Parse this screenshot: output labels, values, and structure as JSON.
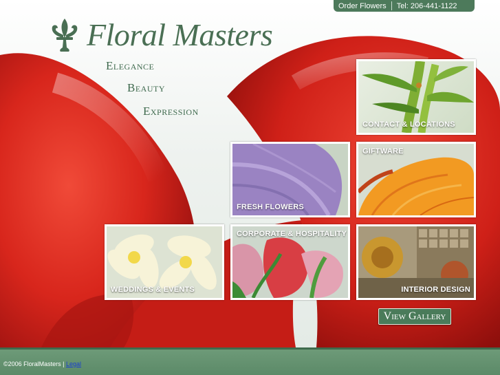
{
  "topbar": {
    "order_label": "Order Flowers",
    "phone_label": "Tel: 206-441-1122"
  },
  "brand": {
    "name": "Floral Masters",
    "logo_icon": "fleur-de-lis-icon"
  },
  "taglines": [
    "Elegance",
    "Beauty",
    "Expression"
  ],
  "tiles": [
    {
      "label": "CONTACT & LOCATIONS"
    },
    {
      "label": "GIFTWARE"
    },
    {
      "label": "FRESH FLOWERS"
    },
    {
      "label": "CORPORATE & HOSPITALITY"
    },
    {
      "label": "WEDDINGS & EVENTS"
    },
    {
      "label": "INTERIOR DESIGN"
    }
  ],
  "gallery_button": "View Gallery",
  "footer": {
    "copyright": "©2006 FloralMasters |",
    "legal_link": "Legal"
  },
  "colors": {
    "brand_green": "#4d7a5b",
    "petal_red": "#d8261c"
  }
}
